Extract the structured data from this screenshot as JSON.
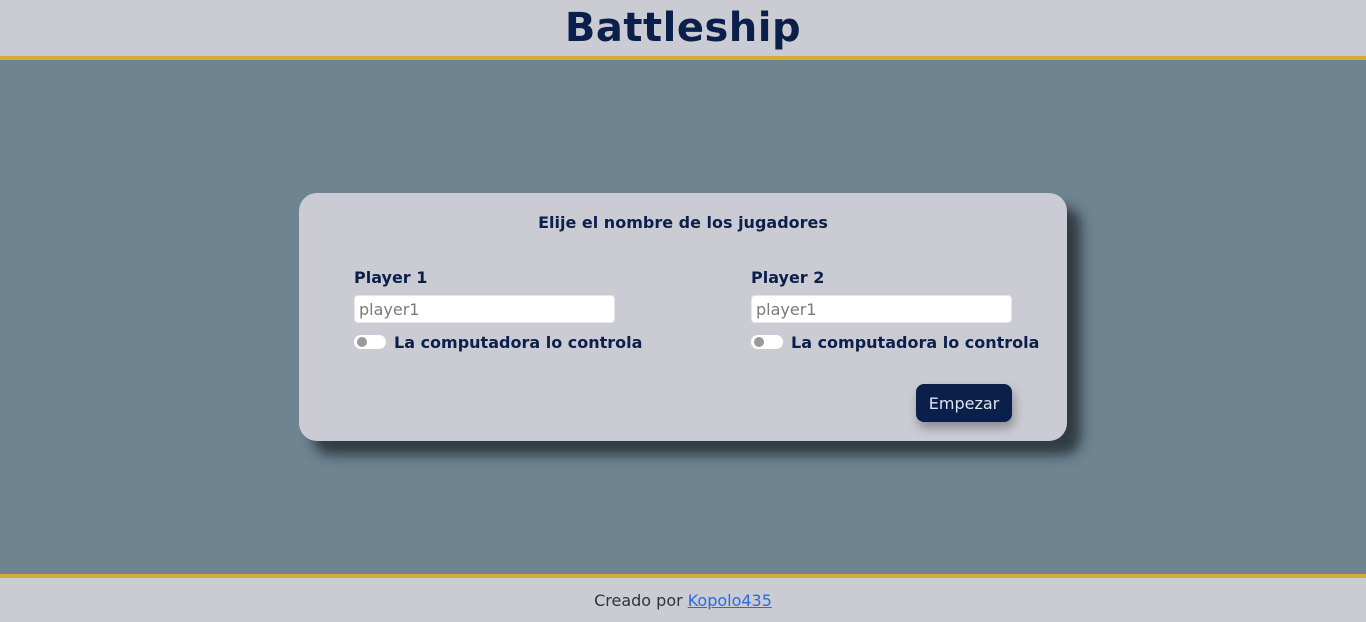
{
  "header": {
    "title": "Battleship"
  },
  "setup": {
    "title": "Elije el nombre de los jugadores",
    "players": [
      {
        "label": "Player 1",
        "placeholder": "player1",
        "value": "",
        "computer_toggle": {
          "label": "La computadora lo controla",
          "checked": false
        }
      },
      {
        "label": "Player 2",
        "placeholder": "player1",
        "value": "",
        "computer_toggle": {
          "label": "La computadora lo controla",
          "checked": false
        }
      }
    ],
    "start_label": "Empezar"
  },
  "footer": {
    "prefix": "Creado por",
    "author_link": "Kopolo435"
  },
  "colors": {
    "navy": "#0b1f4b",
    "panel": "#cbcbd3",
    "background": "#6e8491",
    "accent_gold": "#d3ad33",
    "link": "#2a6ce0"
  }
}
